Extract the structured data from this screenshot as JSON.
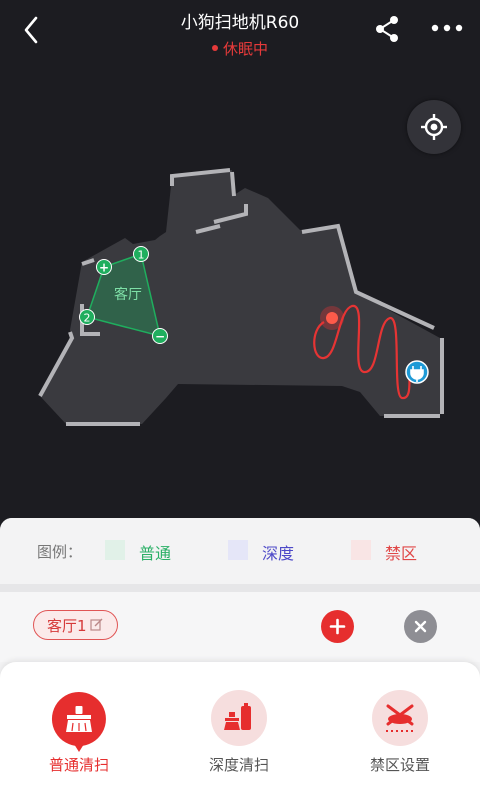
{
  "header": {
    "title": "小狗扫地机R60",
    "status": "休眠中"
  },
  "map": {
    "room_label": "客厅",
    "vertex_add_symbol": "+",
    "vertex_remove_symbol": "−",
    "vertex_1": "1",
    "vertex_2": "2",
    "charging_icon": "plug-icon",
    "robot_icon": "robot-position-icon"
  },
  "legend": {
    "label": "图例：",
    "items": [
      {
        "name": "普通",
        "swatch": "#e1f1e8",
        "text_color": "#2bb067"
      },
      {
        "name": "深度",
        "swatch": "#e5e6f8",
        "text_color": "#4d49c8"
      },
      {
        "name": "禁区",
        "swatch": "#f9e5e5",
        "text_color": "#e04747"
      }
    ]
  },
  "room": {
    "tag_label": "客厅1"
  },
  "modes": [
    {
      "label": "普通清扫",
      "active": true
    },
    {
      "label": "深度清扫",
      "active": false
    },
    {
      "label": "禁区设置",
      "active": false
    }
  ],
  "colors": {
    "accent_red": "#e62e2e",
    "map_floor": "#3a3a3f",
    "room_green": "#1fae5e",
    "dock_blue": "#1e9ad6"
  }
}
